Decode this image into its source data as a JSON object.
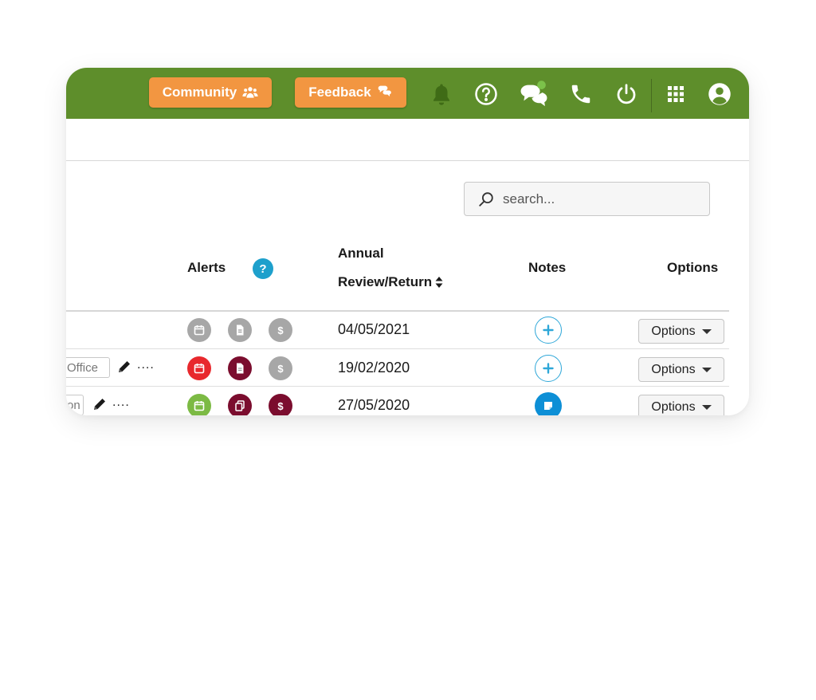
{
  "topbar": {
    "community_label": "Community",
    "feedback_label": "Feedback",
    "icons": [
      "bell-icon",
      "help-circle-icon",
      "chat-bubbles-icon",
      "phone-icon",
      "power-icon",
      "apps-grid-icon",
      "user-account-icon"
    ],
    "chat_indicator_color": "#7cc24a",
    "bar_color": "#5e8e2b",
    "pill_color": "#f29641"
  },
  "search": {
    "placeholder": "search..."
  },
  "table": {
    "headers": {
      "alerts": "Alerts",
      "alerts_help": "?",
      "annual_line1": "Annual",
      "annual_line2": "Review/Return",
      "notes": "Notes",
      "options": "Options"
    },
    "rows": [
      {
        "tag": "",
        "show_edit": false,
        "edit_dots": "....",
        "alerts": [
          {
            "icon": "calendar-icon",
            "color": "#a7a7a7"
          },
          {
            "icon": "document-icon",
            "color": "#a7a7a7"
          },
          {
            "icon": "dollar-icon",
            "color": "#a7a7a7"
          }
        ],
        "date": "04/05/2021",
        "note": "add",
        "options_label": "Options"
      },
      {
        "tag": "Office",
        "show_edit": true,
        "edit_dots": "....",
        "alerts": [
          {
            "icon": "calendar-icon",
            "color": "#e8282d"
          },
          {
            "icon": "document-icon",
            "color": "#7b0d2e"
          },
          {
            "icon": "dollar-icon",
            "color": "#a7a7a7"
          }
        ],
        "date": "19/02/2020",
        "note": "add",
        "options_label": "Options"
      },
      {
        "tag": "on",
        "show_edit": true,
        "edit_dots": "....",
        "alerts": [
          {
            "icon": "calendar-icon",
            "color": "#7cba44"
          },
          {
            "icon": "copy-document-icon",
            "color": "#7b0d2e"
          },
          {
            "icon": "dollar-icon",
            "color": "#7b0d2e"
          }
        ],
        "date": "27/05/2020",
        "note": "has-note",
        "options_label": "Options"
      }
    ]
  }
}
